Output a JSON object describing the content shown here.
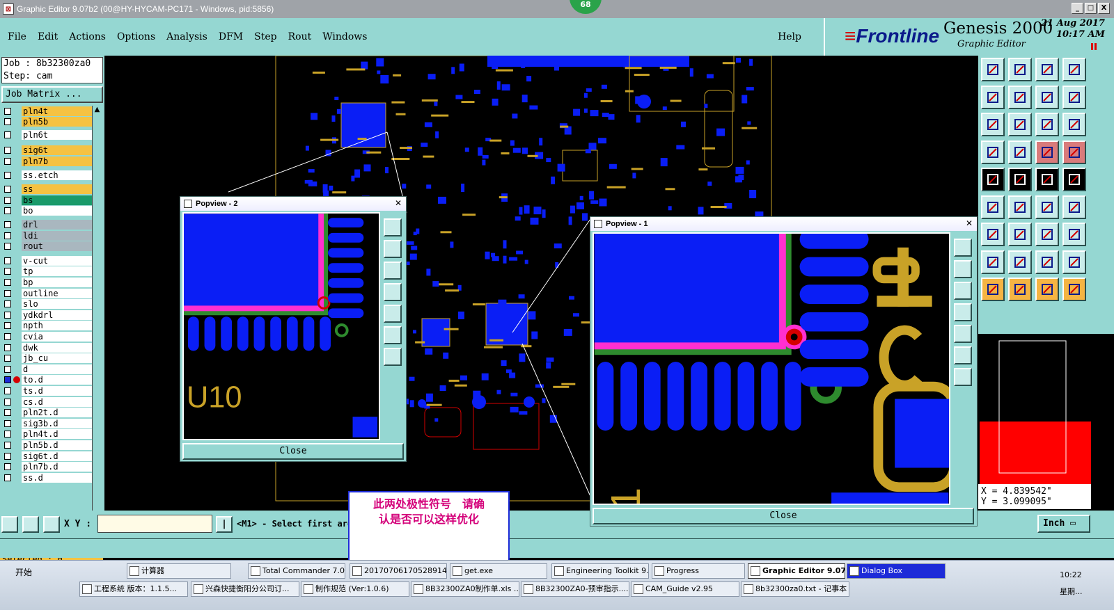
{
  "window": {
    "title": "Graphic Editor 9.07b2 (00@HY-HYCAM-PC171 - Windows, pid:5856)",
    "badge": "68",
    "min_label": "_",
    "max_label": "□",
    "close_label": "X"
  },
  "menu": {
    "items": [
      "File",
      "Edit",
      "Actions",
      "Options",
      "Analysis",
      "DFM",
      "Step",
      "Rout",
      "Windows"
    ],
    "help": "Help"
  },
  "branding": {
    "frontline": "Frontline",
    "genesis": "Genesis 2000",
    "subtitle": "Graphic Editor",
    "date": "21 Aug 2017",
    "time": "10:17 AM"
  },
  "job": {
    "job_line": "Job : 8b32300za0",
    "step_line": "Step: cam",
    "matrix_button": "Job Matrix ..."
  },
  "layers": [
    {
      "name": "pln4t",
      "color": "#f5c242"
    },
    {
      "name": "pln5b",
      "color": "#f5c242"
    },
    {
      "name": "pln6t",
      "color": "#ffffff"
    },
    {
      "name": "sig6t",
      "color": "#f5c242"
    },
    {
      "name": "pln7b",
      "color": "#f5c242"
    },
    {
      "name": "ss.etch",
      "color": "#ffffff"
    },
    {
      "name": "ss",
      "color": "#f5c242"
    },
    {
      "name": "bs",
      "color": "#1a9a6a"
    },
    {
      "name": "bo",
      "color": "#ffffff"
    },
    {
      "name": "drl",
      "color": "#a9b7bf"
    },
    {
      "name": "ldi",
      "color": "#a9b7bf"
    },
    {
      "name": "rout",
      "color": "#a9b7bf"
    },
    {
      "name": "v-cut",
      "color": "#ffffff"
    },
    {
      "name": "tp",
      "color": "#ffffff"
    },
    {
      "name": "bp",
      "color": "#ffffff"
    },
    {
      "name": "outline",
      "color": "#ffffff"
    },
    {
      "name": "slo",
      "color": "#ffffff"
    },
    {
      "name": "ydkdrl",
      "color": "#ffffff"
    },
    {
      "name": "npth",
      "color": "#ffffff"
    },
    {
      "name": "cvia",
      "color": "#ffffff"
    },
    {
      "name": "dwk",
      "color": "#ffffff"
    },
    {
      "name": "jb_cu",
      "color": "#ffffff"
    },
    {
      "name": "d",
      "color": "#ffffff"
    },
    {
      "name": "to.d",
      "color": "#ffffff",
      "active": true
    },
    {
      "name": "ts.d",
      "color": "#ffffff"
    },
    {
      "name": "cs.d",
      "color": "#ffffff"
    },
    {
      "name": "pln2t.d",
      "color": "#ffffff"
    },
    {
      "name": "sig3b.d",
      "color": "#ffffff"
    },
    {
      "name": "pln4t.d",
      "color": "#ffffff"
    },
    {
      "name": "pln5b.d",
      "color": "#ffffff"
    },
    {
      "name": "sig6t.d",
      "color": "#ffffff"
    },
    {
      "name": "pln7b.d",
      "color": "#ffffff"
    },
    {
      "name": "ss.d",
      "color": "#ffffff"
    }
  ],
  "selected": "Selected : 0",
  "coords": {
    "x": "X = 4.839542\"",
    "y": "Y = 3.099095\""
  },
  "bottom": {
    "xy_label": "X Y :",
    "xy_value": "",
    "message": "<M1> - Select first are",
    "unit": "Inch"
  },
  "popview2": {
    "title": "Popview - 2",
    "close": "Close",
    "ref_text": "U10"
  },
  "popview1": {
    "title": "Popview - 1",
    "close": "Close",
    "ref_text": "1"
  },
  "annotation": {
    "line1": "此两处极性符号　请确",
    "line2": "认是否可以这样优化"
  },
  "taskbar": {
    "start": "开始",
    "tasks": [
      "计算器",
      "Total Commander 7.0...",
      "20170706170528914...",
      "get.exe",
      "Engineering Toolkit 9....",
      "Progress",
      "Graphic Editor 9.07...",
      "Dialog Box",
      "工程系统  版本：1.1.5...",
      "兴森快捷衡阳分公司订...",
      "制作规范 (Ver:1.0.6)",
      "8B32300ZA0制作单.xls ...",
      "8B32300ZA0-预审指示....",
      "CAM_Guide v2.95",
      "8b32300za0.txt - 记事本"
    ],
    "clock": "10:22",
    "day": "星期..."
  },
  "colors": {
    "panel": "#95d7d2",
    "pad_blue": "#0a1ef5",
    "silk_gold": "#c9a227",
    "layer_magenta": "#ff2fd0",
    "layer_green": "#2e8b2e",
    "accent_red": "#d40000"
  }
}
